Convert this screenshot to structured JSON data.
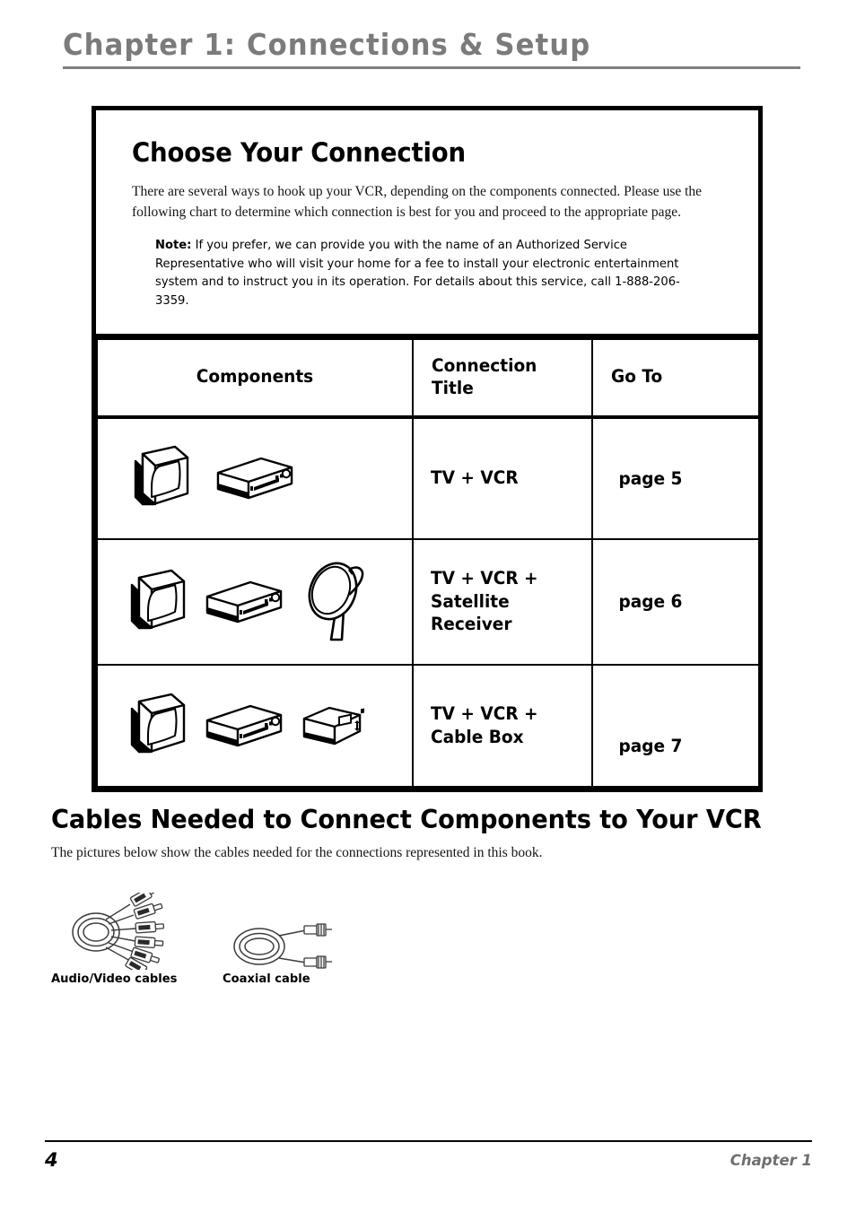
{
  "header": {
    "chapter_title": "Chapter 1: Connections & Setup"
  },
  "chart_box": {
    "title": "Choose Your Connection",
    "intro_paragraph": "There are several ways to hook up your VCR, depending on the components connected. Please use the following chart to determine which connection is best for you and proceed to the appropriate page.",
    "note_label": "Note:",
    "note_text": " If you prefer, we can provide you with the name of an Authorized Service Representative who will visit your home for a fee to install your electronic entertainment system and to instruct you in its operation. For details about this service, call 1-888-206-3359.",
    "table": {
      "headers": {
        "components": "Components",
        "connection_title_line1": "Connection",
        "connection_title_line2": "Title",
        "go_to": "Go To"
      },
      "rows": [
        {
          "icons": [
            "tv-icon",
            "vcr-icon"
          ],
          "connection_title_line1": "TV + VCR",
          "connection_title_line2": "",
          "go_to": "page 5"
        },
        {
          "icons": [
            "tv-icon",
            "vcr-icon",
            "satellite-dish-icon"
          ],
          "connection_title_line1": "TV + VCR +",
          "connection_title_line2": "Satellite Receiver",
          "go_to": "page 6"
        },
        {
          "icons": [
            "tv-icon",
            "vcr-icon",
            "cable-box-icon"
          ],
          "connection_title_line1": "TV + VCR +",
          "connection_title_line2": "Cable Box",
          "go_to": "page 7"
        }
      ]
    }
  },
  "cables_section": {
    "heading": "Cables Needed to Connect Components to Your VCR",
    "subtext": "The pictures below show the cables needed for the connections represented in this book.",
    "figures": [
      {
        "icon": "audio-video-cables-icon",
        "caption": "Audio/Video cables"
      },
      {
        "icon": "coaxial-cable-icon",
        "caption": "Coaxial cable"
      }
    ]
  },
  "footer": {
    "page_number": "4",
    "chapter_label": "Chapter 1"
  },
  "colors": {
    "header_gray": "#7b7b7b",
    "rule_gray": "#808080",
    "footer_gray": "#6f6f6f",
    "ink": "#000000",
    "page_background": "#ffffff"
  }
}
